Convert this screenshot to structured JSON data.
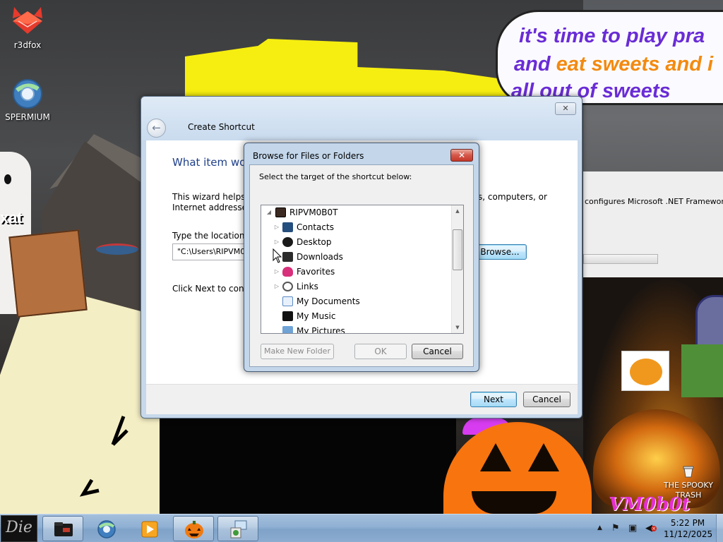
{
  "desktop": {
    "icons": [
      {
        "label": "r3dfox",
        "icon": "r3dfox-icon"
      },
      {
        "label": "SPERMIUM",
        "icon": "browser-globe-icon"
      },
      {
        "label": "THE SPOOKY TRASH",
        "icon": "recycle-bin-icon"
      }
    ],
    "wallpaper": {
      "bubble_line1": "it's time to play pra",
      "bubble_line2_a": "and ",
      "bubble_line2_b": "eat sweets and i",
      "bubble_line3": "all out of sweets",
      "ghost_text": "xat",
      "logo_text": "VM0b0t",
      "bg_info_text": "configures Microsoft .NET Framework"
    }
  },
  "wizard": {
    "title": "Create Shortcut",
    "close_label": "✕",
    "back_label": "←",
    "heading": "What item wou",
    "intro_line1": "This wizard helps y",
    "intro_line1_right": "s, computers, or",
    "intro_line2": "Internet addresses.",
    "location_label": "Type the location o",
    "location_value": "\"C:\\Users\\RIPVM0",
    "browse_label": "Browse...",
    "next_hint": "Click Next to contir",
    "next_label": "Next",
    "cancel_label": "Cancel"
  },
  "browse": {
    "title": "Browse for Files or Folders",
    "close_label": "✕",
    "prompt": "Select the target of the shortcut below:",
    "tree": [
      {
        "label": "RIPVM0B0T",
        "icon": "computer-icon",
        "expanded": true,
        "level": 0
      },
      {
        "label": "Contacts",
        "icon": "contacts-icon",
        "level": 1
      },
      {
        "label": "Desktop",
        "icon": "desktop-folder-icon",
        "level": 1
      },
      {
        "label": "Downloads",
        "icon": "downloads-icon",
        "level": 1
      },
      {
        "label": "Favorites",
        "icon": "favorites-icon",
        "level": 1
      },
      {
        "label": "Links",
        "icon": "links-icon",
        "level": 1
      },
      {
        "label": "My Documents",
        "icon": "documents-icon",
        "level": 1
      },
      {
        "label": "My Music",
        "icon": "music-icon",
        "level": 1
      },
      {
        "label": "My Pictures",
        "icon": "pictures-icon",
        "level": 1
      }
    ],
    "make_new_folder_label": "Make New Folder",
    "ok_label": "OK",
    "cancel_label": "Cancel"
  },
  "taskbar": {
    "start_label": "Die",
    "buttons": [
      {
        "name": "explorer-icon"
      },
      {
        "name": "browser-globe-icon"
      },
      {
        "name": "media-player-icon"
      },
      {
        "name": "pumpkin-icon"
      },
      {
        "name": "shortcut-wizard-icon"
      }
    ],
    "tray": {
      "time": "5:22 PM",
      "date": "11/12/2025"
    }
  }
}
